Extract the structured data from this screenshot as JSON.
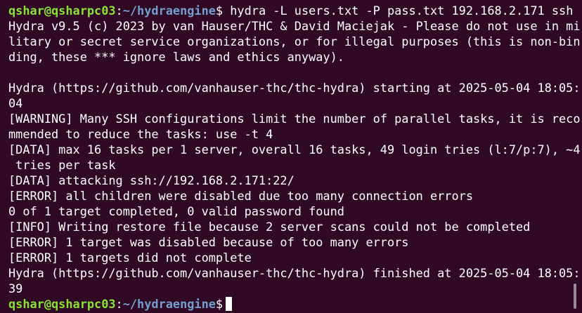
{
  "terminal": {
    "prompt": {
      "user_host": "qshar@qsharpc03",
      "separator": ":",
      "path": "~/hydraengine",
      "symbol": "$"
    },
    "command": " hydra -L users.txt -P pass.txt 192.168.2.171 ssh",
    "output": [
      "Hydra v9.5 (c) 2023 by van Hauser/THC & David Maciejak - Please do not use in mi",
      "litary or secret service organizations, or for illegal purposes (this is non-bin",
      "ding, these *** ignore laws and ethics anyway).",
      "",
      "Hydra (https://github.com/vanhauser-thc/thc-hydra) starting at 2025-05-04 18:05:",
      "04",
      "[WARNING] Many SSH configurations limit the number of parallel tasks, it is reco",
      "mmended to reduce the tasks: use -t 4",
      "[DATA] max 16 tasks per 1 server, overall 16 tasks, 49 login tries (l:7/p:7), ~4",
      " tries per task",
      "[DATA] attacking ssh://192.168.2.171:22/",
      "[ERROR] all children were disabled due too many connection errors",
      "0 of 1 target completed, 0 valid password found",
      "[INFO] Writing restore file because 2 server scans could not be completed",
      "[ERROR] 1 target was disabled because of too many errors",
      "[ERROR] 1 targets did not complete",
      "Hydra (https://github.com/vanhauser-thc/thc-hydra) finished at 2025-05-04 18:05:",
      "39"
    ],
    "colors": {
      "background": "#300a24",
      "text": "#ffffff",
      "prompt_user": "#8ae234",
      "prompt_path": "#729fcf"
    }
  }
}
